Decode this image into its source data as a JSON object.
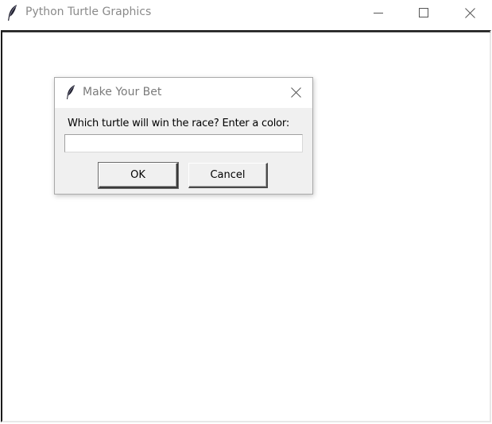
{
  "window": {
    "title": "Python Turtle Graphics",
    "icon": "feather-icon",
    "controls": {
      "minimize": "minimize-icon",
      "maximize": "maximize-icon",
      "close": "close-icon"
    }
  },
  "dialog": {
    "title": "Make Your Bet",
    "icon": "feather-icon",
    "prompt": "Which turtle will win the race? Enter a color:",
    "input_value": "",
    "ok_label": "OK",
    "cancel_label": "Cancel"
  },
  "colors": {
    "title_text": "#8a8a8a",
    "dialog_bg": "#f0f0f0",
    "canvas_bg": "#ffffff"
  }
}
